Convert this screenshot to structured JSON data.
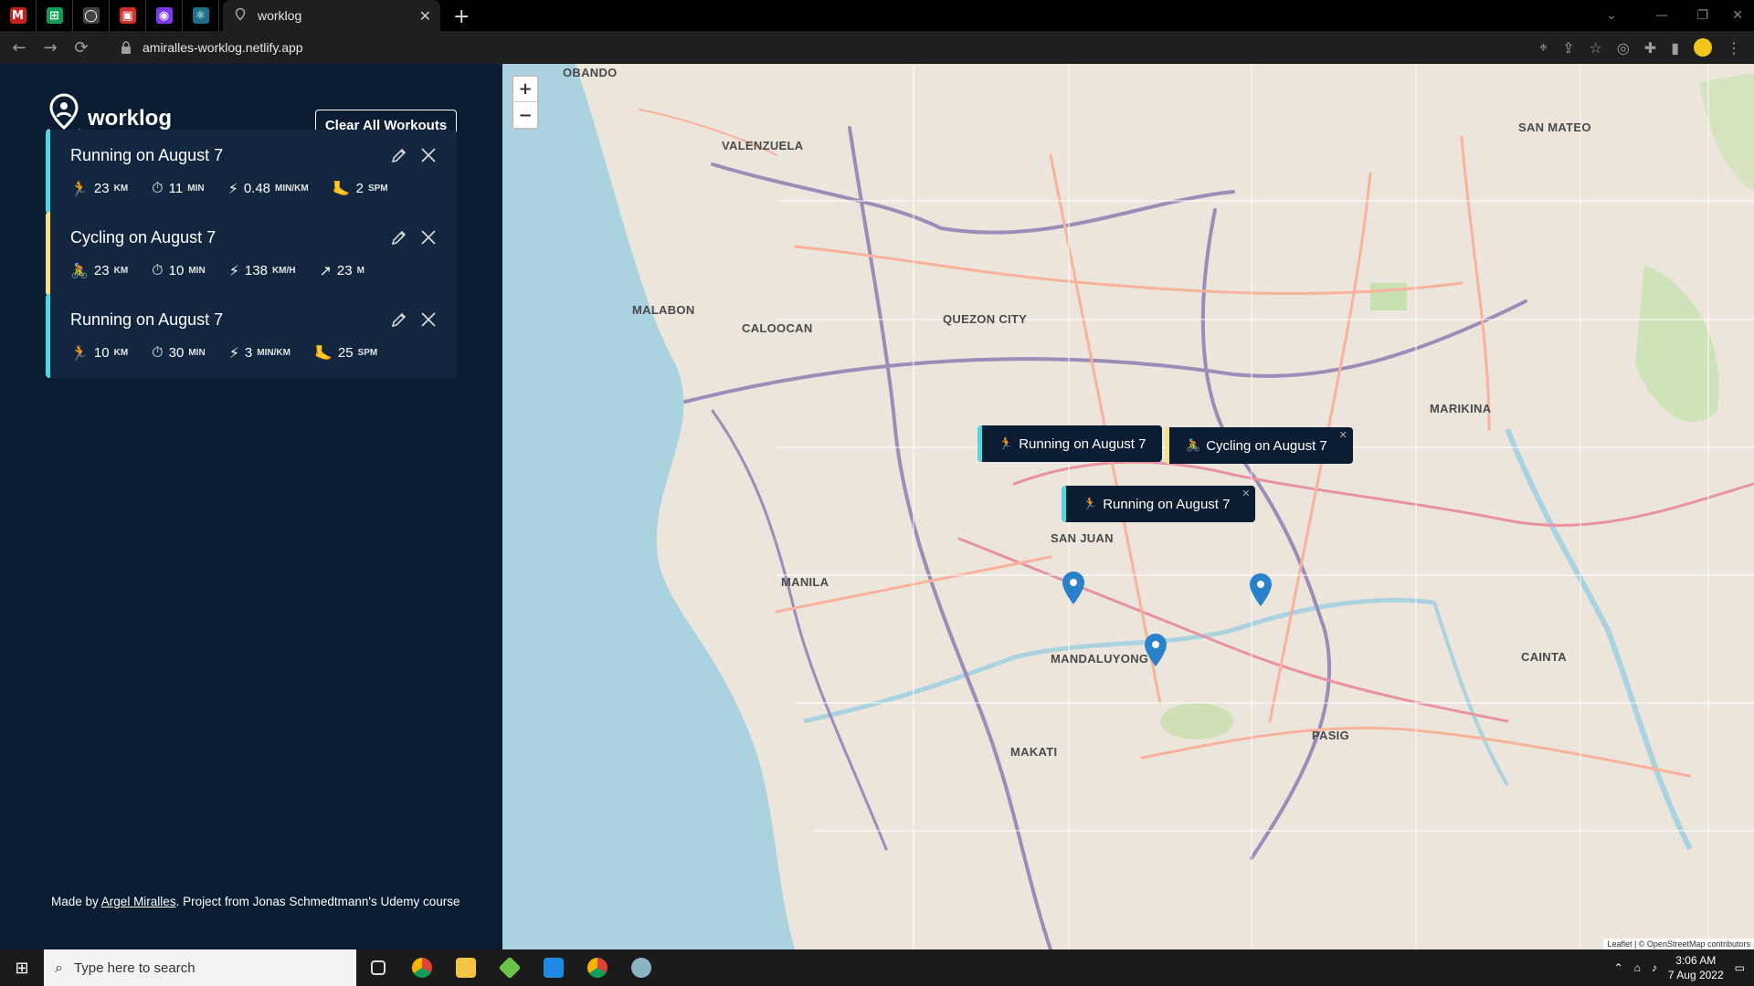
{
  "browser": {
    "pinned_tabs": [
      {
        "icon": "gmail-icon",
        "glyph": "M",
        "color": "#c5221f"
      },
      {
        "icon": "sheets-icon",
        "glyph": "⊞",
        "color": "#0f9d58"
      },
      {
        "icon": "github-icon",
        "glyph": "◯",
        "color": "#444"
      },
      {
        "icon": "app-icon",
        "glyph": "▣",
        "color": "#d32f2f"
      },
      {
        "icon": "app2-icon",
        "glyph": "◉",
        "color": "#7c3aed"
      },
      {
        "icon": "react-icon",
        "glyph": "⚛",
        "color": "#1f6f8b"
      }
    ],
    "active_tab": {
      "title": "worklog",
      "icon": "map-pin-user-icon"
    },
    "url": "amiralles-worklog.netlify.app"
  },
  "sidebar": {
    "logo_text": "worklog",
    "clear_button": "Clear All Workouts",
    "workouts": [
      {
        "type": "running",
        "title": "Running on August 7",
        "stats": [
          {
            "icon": "runner-icon",
            "glyph": "🏃",
            "value": "23",
            "unit": "KM"
          },
          {
            "icon": "stopwatch-icon",
            "glyph": "⏱",
            "value": "11",
            "unit": "MIN"
          },
          {
            "icon": "lightning-icon",
            "glyph": "⚡",
            "value": "0.48",
            "unit": "MIN/KM"
          },
          {
            "icon": "footprint-icon",
            "glyph": "🦶",
            "value": "2",
            "unit": "SPM"
          }
        ]
      },
      {
        "type": "cycling",
        "title": "Cycling on August 7",
        "stats": [
          {
            "icon": "cyclist-icon",
            "glyph": "🚴",
            "value": "23",
            "unit": "KM"
          },
          {
            "icon": "stopwatch-icon",
            "glyph": "⏱",
            "value": "10",
            "unit": "MIN"
          },
          {
            "icon": "lightning-icon",
            "glyph": "⚡",
            "value": "138",
            "unit": "KM/H"
          },
          {
            "icon": "elevation-icon",
            "glyph": "↗",
            "value": "23",
            "unit": "M"
          }
        ]
      },
      {
        "type": "running",
        "title": "Running on August 7",
        "stats": [
          {
            "icon": "runner-icon",
            "glyph": "🏃",
            "value": "10",
            "unit": "KM"
          },
          {
            "icon": "stopwatch-icon",
            "glyph": "⏱",
            "value": "30",
            "unit": "MIN"
          },
          {
            "icon": "lightning-icon",
            "glyph": "⚡",
            "value": "3",
            "unit": "MIN/KM"
          },
          {
            "icon": "footprint-icon",
            "glyph": "🦶",
            "value": "25",
            "unit": "SPM"
          }
        ]
      }
    ],
    "footer": {
      "prefix": "Made by ",
      "author": "Argel Miralles",
      "suffix": ". Project from Jonas Schmedtmann's Udemy course"
    }
  },
  "map": {
    "zoom_in": "+",
    "zoom_out": "−",
    "labels": [
      "OBANDO",
      "VALENZUELA",
      "MALABON",
      "CALOOCAN",
      "QUEZON CITY",
      "MARIKINA",
      "SAN MATEO",
      "SAN JUAN",
      "MANILA",
      "MANDALUYONG",
      "MAKATI",
      "PASIG",
      "CAINTA"
    ],
    "popups": [
      {
        "text": "Running on August 7",
        "type": "running"
      },
      {
        "text": "Cycling on August 7",
        "type": "cycling"
      },
      {
        "text": "Running on August 7",
        "type": "running"
      }
    ],
    "attribution": "Leaflet | © OpenStreetMap contributors"
  },
  "taskbar": {
    "search_placeholder": "Type here to search",
    "time": "3:06 AM",
    "date": "7 Aug 2022"
  },
  "colors": {
    "sidebar_bg": "#0b1d33",
    "card_bg": "#12263f",
    "running_accent": "#54d5e0",
    "cycling_accent": "#f3e089"
  }
}
